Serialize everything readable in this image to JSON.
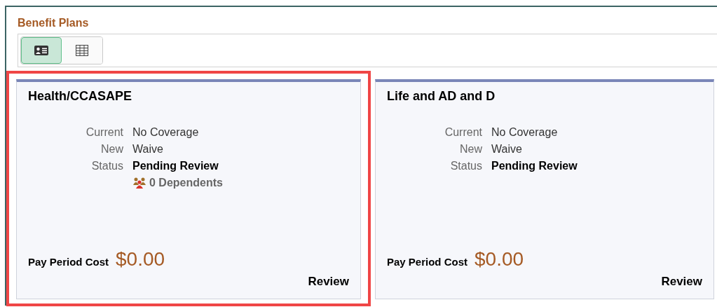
{
  "section_title": "Benefit Plans",
  "view_toggle": [
    {
      "kind": "card",
      "selected": true
    },
    {
      "kind": "grid",
      "selected": false
    }
  ],
  "plans": [
    {
      "title": "Health/CCASAPE",
      "highlighted": true,
      "fields": [
        {
          "label": "Current",
          "value": "No Coverage",
          "kind": "plain"
        },
        {
          "label": "New",
          "value": "Waive",
          "kind": "plain"
        },
        {
          "label": "Status",
          "value": "Pending Review",
          "kind": "strong"
        }
      ],
      "dependents": "0 Dependents",
      "cost_label": "Pay Period Cost",
      "cost": "$0.00",
      "action": "Review"
    },
    {
      "title": "Life and AD and D",
      "highlighted": false,
      "fields": [
        {
          "label": "Current",
          "value": "No Coverage",
          "kind": "plain"
        },
        {
          "label": "New",
          "value": "Waive",
          "kind": "plain"
        },
        {
          "label": "Status",
          "value": "Pending Review",
          "kind": "strong"
        }
      ],
      "cost_label": "Pay Period Cost",
      "cost": "$0.00",
      "action": "Review"
    }
  ]
}
